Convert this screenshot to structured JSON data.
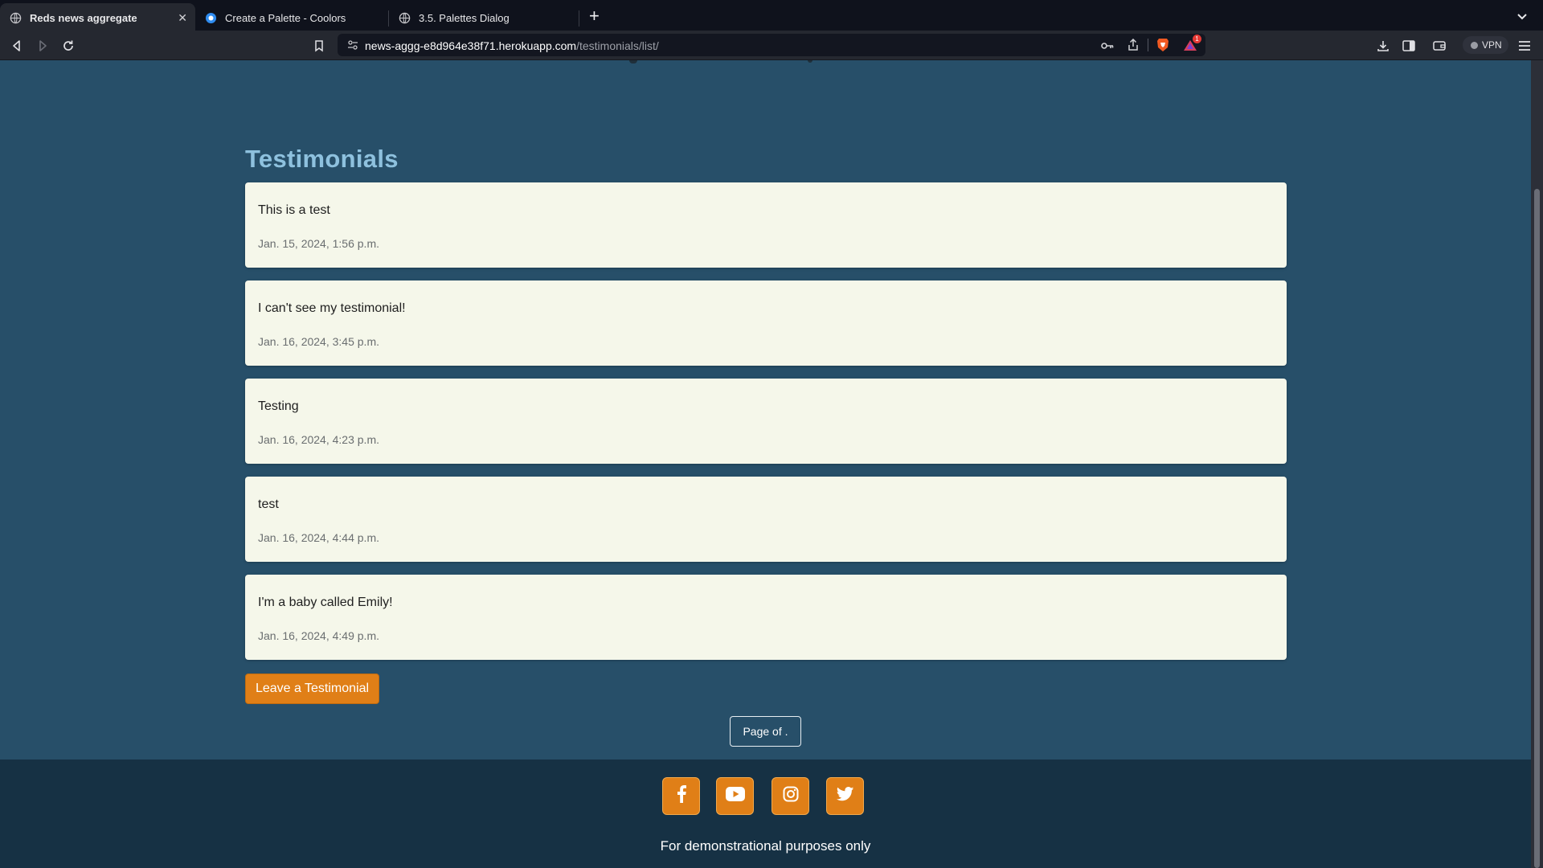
{
  "browser": {
    "tabs": [
      {
        "title": "Reds news aggregate",
        "active": true,
        "icon": "globe-icon"
      },
      {
        "title": "Create a Palette - Coolors",
        "active": false,
        "icon": "coolors-icon"
      },
      {
        "title": "3.5. Palettes Dialog",
        "active": false,
        "icon": "globe-icon"
      }
    ],
    "url_domain": "news-aggg-e8d964e38f71.herokuapp.com",
    "url_path": "/testimonials/list/",
    "vpn_label": "VPN",
    "notification_count": "1"
  },
  "page": {
    "title": "Testimonials",
    "testimonials": [
      {
        "text": "This is a test",
        "date": "Jan. 15, 2024, 1:56 p.m."
      },
      {
        "text": "I can't see my testimonial!",
        "date": "Jan. 16, 2024, 3:45 p.m."
      },
      {
        "text": "Testing",
        "date": "Jan. 16, 2024, 4:23 p.m."
      },
      {
        "text": "test",
        "date": "Jan. 16, 2024, 4:44 p.m."
      },
      {
        "text": "I'm a baby called Emily!",
        "date": "Jan. 16, 2024, 4:49 p.m."
      }
    ],
    "leave_button": "Leave a Testimonial",
    "pagination": "Page of ."
  },
  "footer": {
    "social": [
      "facebook-icon",
      "youtube-icon",
      "instagram-icon",
      "twitter-icon"
    ],
    "text": "For demonstrational purposes only"
  },
  "colors": {
    "page_bg": "#274f69",
    "footer_bg": "#163144",
    "accent": "#e07f17",
    "card_bg": "#f5f7ea",
    "title": "#8ec1de"
  }
}
